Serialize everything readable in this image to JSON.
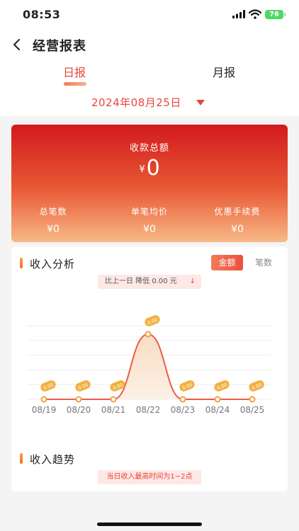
{
  "status": {
    "time": "08:53",
    "battery": "76"
  },
  "nav": {
    "title": "经营报表",
    "back_icon": "chevron-left-icon"
  },
  "tabs": [
    {
      "label": "日报",
      "active": true
    },
    {
      "label": "月报",
      "active": false
    }
  ],
  "date": {
    "value": "2024年08月25日"
  },
  "summary": {
    "total_label": "收款总额",
    "currency": "¥",
    "total_value": "0",
    "stats": [
      {
        "label": "总笔数",
        "value": "¥0"
      },
      {
        "label": "单笔均价",
        "value": "¥0"
      },
      {
        "label": "优惠手续费",
        "value": "¥0"
      }
    ]
  },
  "analysis": {
    "title": "收入分析",
    "segments": [
      {
        "label": "金额",
        "active": true
      },
      {
        "label": "笔数",
        "active": false
      }
    ],
    "compare_text": "比上一日 降低 0.00 元",
    "compare_icon": "arrow-down-icon"
  },
  "trend": {
    "title": "收入趋势",
    "peak_text": "当日收入最高时间为1~2点"
  },
  "colors": {
    "accent": "#e8463a",
    "card_top": "#d21a1e",
    "card_bottom": "#f8b987"
  },
  "chart_data": {
    "type": "area",
    "categories": [
      "08/19",
      "08/20",
      "08/21",
      "08/22",
      "08/23",
      "08/24",
      "08/25"
    ],
    "series": [
      {
        "values": [
          0,
          0,
          0,
          0,
          0,
          0,
          0
        ]
      }
    ],
    "data_labels": [
      "0.00",
      "0.00",
      "0.00",
      "0.00",
      "0.00",
      "0.00",
      "0.00"
    ],
    "grid": true,
    "color": "#ee5a45"
  }
}
